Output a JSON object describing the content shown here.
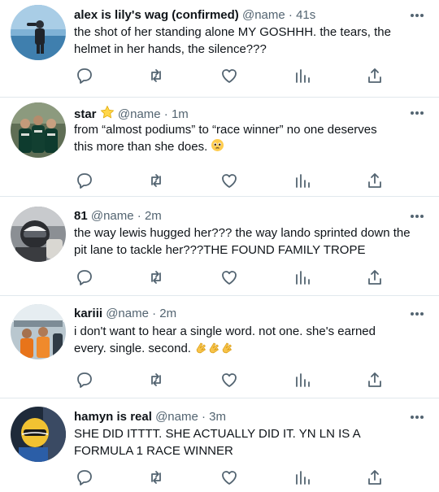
{
  "tweets": [
    {
      "display_name": "alex is lily's wag (confirmed)",
      "handle": "@name",
      "separator": "·",
      "time": "41s",
      "text": "the shot of her standing alone MY GOSHHH. the tears, the helmet in her hands, the silence???",
      "avatar": "avatar-person-ocean"
    },
    {
      "display_name": "star",
      "name_badge": "star-emoji",
      "handle": "@name",
      "separator": "·",
      "time": "1m",
      "text_line1": "from “almost podiums” to “race winner” no one deserves",
      "text_line2": "this more than she does.",
      "trailing_emoji": "pleading-face-emoji",
      "avatar": "avatar-team-group"
    },
    {
      "display_name": "81",
      "handle": "@name",
      "separator": "·",
      "time": "2m",
      "text": "the way lewis hugged her??? the way lando sprinted down the pit lane to tackle her???THE FOUND FAMILY TROPE",
      "avatar": "avatar-helmet-driver"
    },
    {
      "display_name": "kariii",
      "handle": "@name",
      "separator": "·",
      "time": "2m",
      "text_line1": "i don't want to hear a single word. not one. she's earned",
      "text_line2": "every. single. second.",
      "trailing_emoji": "clapping-hands-emoji x3",
      "avatar": "avatar-paddock-crew"
    },
    {
      "display_name": "hamyn is real",
      "handle": "@name",
      "separator": "·",
      "time": "3m",
      "text": "SHE DID ITTTT. SHE ACTUALLY DID IT. YN LN IS A FORMULA 1 RACE WINNER",
      "avatar": "avatar-yellow-helmet"
    }
  ],
  "actions": [
    "reply-icon",
    "retweet-icon",
    "like-icon",
    "analytics-icon",
    "share-icon"
  ],
  "colors": {
    "text": "#0f1419",
    "meta": "#536471",
    "icon": "#536471",
    "divider": "#e1e8ed"
  }
}
